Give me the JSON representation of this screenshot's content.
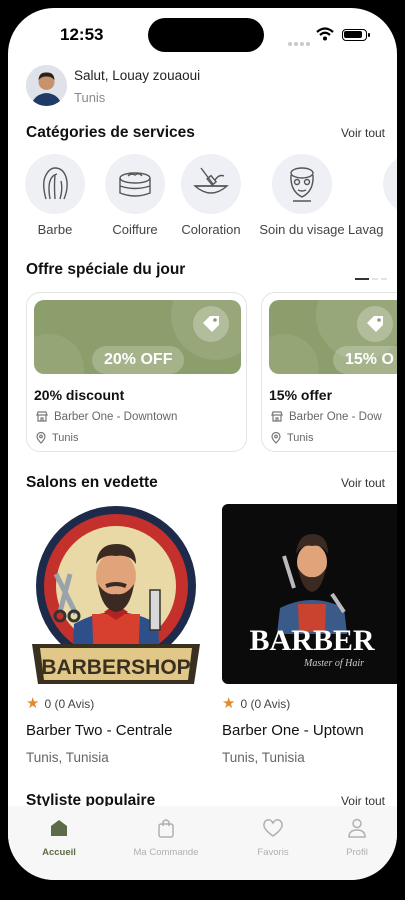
{
  "status": {
    "time": "12:53"
  },
  "greeting": {
    "hello": "Salut, Louay zouaoui",
    "city": "Tunis"
  },
  "categories": {
    "title": "Catégories de services",
    "see_all": "Voir tout",
    "items": [
      {
        "label": "Barbe",
        "icon": "hair-icon"
      },
      {
        "label": "Coiffure",
        "icon": "hair-products-icon"
      },
      {
        "label": "Coloration",
        "icon": "hair-dye-bowl-icon"
      },
      {
        "label": "Soin du visage",
        "icon": "face-mask-icon"
      },
      {
        "label": "Lavag",
        "icon": "wash-icon"
      }
    ]
  },
  "offers": {
    "title": "Offre spéciale du jour",
    "items": [
      {
        "badge": "20% OFF",
        "title": "20% discount",
        "shop": "Barber One - Downtown",
        "location": "Tunis"
      },
      {
        "badge": "15% O",
        "title": "15% offer",
        "shop": "Barber One - Dow",
        "location": "Tunis"
      }
    ]
  },
  "featured": {
    "title": "Salons en vedette",
    "see_all": "Voir tout",
    "items": [
      {
        "rating": "0 (0 Avis)",
        "name": "Barber Two - Centrale",
        "city": "Tunis, Tunisia",
        "logo_text": "BARBERSHOP"
      },
      {
        "rating": "0 (0 Avis)",
        "name": "Barber One - Uptown",
        "city": "Tunis, Tunisia",
        "logo_text": "BARBER",
        "logo_sub": "Master of Hair"
      }
    ]
  },
  "stylists": {
    "title": "Styliste populaire",
    "see_all": "Voir tout"
  },
  "tabbar": {
    "items": [
      {
        "label": "Accueil",
        "icon": "home-icon"
      },
      {
        "label": "Ma Commande",
        "icon": "bag-icon"
      },
      {
        "label": "Favoris",
        "icon": "heart-icon"
      },
      {
        "label": "Profil",
        "icon": "user-icon"
      }
    ]
  },
  "colors": {
    "accent": "#5c6b48",
    "offer_banner": "#8c9e6b",
    "star": "#e48a2a"
  }
}
